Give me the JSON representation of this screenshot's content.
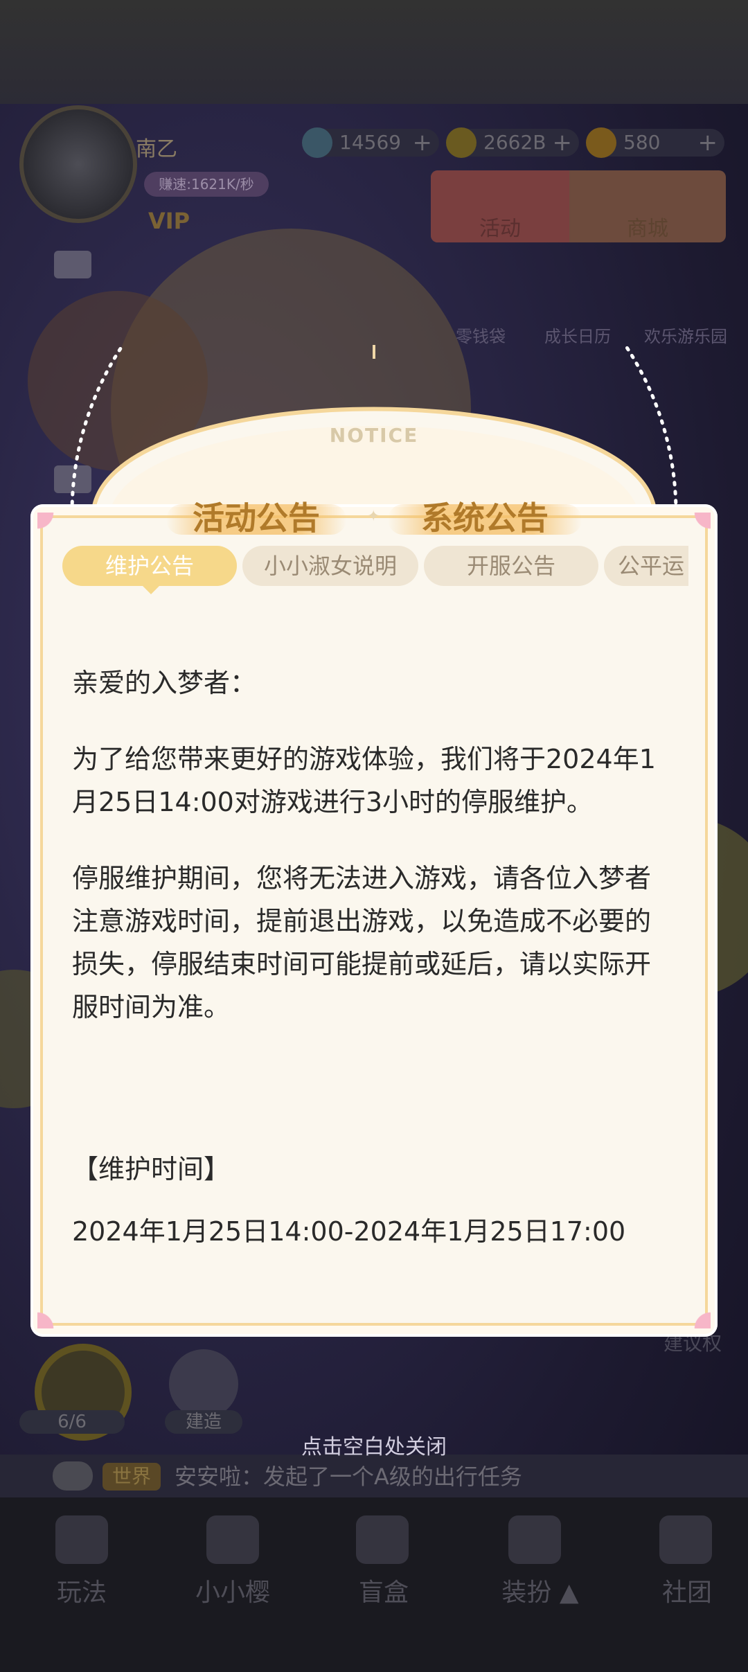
{
  "hud": {
    "player_name": "南乙",
    "speed": "赚速:1621K/秒",
    "vip": "VIP",
    "resources": [
      {
        "icon": "gem-icon",
        "value": "14569"
      },
      {
        "icon": "coin-icon",
        "value": "2662B"
      },
      {
        "icon": "star-icon",
        "value": "580"
      }
    ],
    "menu_activity": "活动",
    "menu_shop": "商城",
    "shortcuts": [
      "零钱袋",
      "成长日历",
      "欢乐游乐园"
    ],
    "gift_count": "6/6",
    "build_label": "建造",
    "suggest_label": "建议权"
  },
  "chat": {
    "channel": "世界",
    "message": "安安啦：发起了一个A级的出行任务"
  },
  "bottom_nav": [
    "玩法",
    "小小樱",
    "盲盒",
    "装扮 ▲",
    "社团"
  ],
  "dialog": {
    "notice": "NOTICE",
    "main_tabs": [
      "活动公告",
      "系统公告"
    ],
    "sub_tabs": [
      "维护公告",
      "小小淑女说明",
      "开服公告",
      "公平运"
    ],
    "active_sub_tab": "维护公告",
    "greeting": "亲爱的入梦者：",
    "para1": "为了给您带来更好的游戏体验，我们将于2024年1月25日14:00对游戏进行3小时的停服维护。",
    "para2": "停服维护期间，您将无法进入游戏，请各位入梦者注意游戏时间，提前退出游戏，以免造成不必要的损失，停服结束时间可能提前或延后，请以实际开服时间为准。",
    "maint_heading": "【维护时间】",
    "maint_time": "2024年1月25日14:00-2024年1月25日17:00"
  },
  "close_hint": "点击空白处关闭",
  "colors": {
    "dialog_bg": "#fbf7ee",
    "dialog_border": "#f5d79b",
    "active_pill": "#f6d88a",
    "tab_text": "#b07a2a",
    "corner_pink": "#f7b6c8"
  }
}
